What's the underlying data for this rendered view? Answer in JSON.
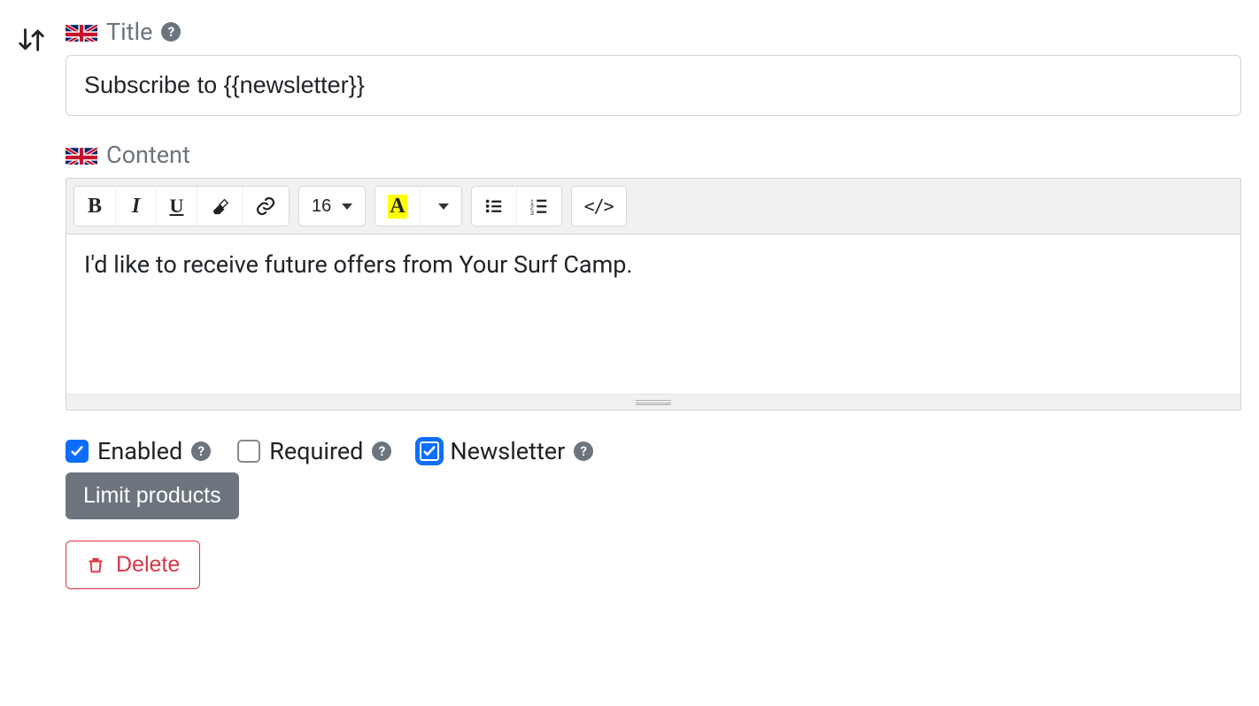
{
  "title": {
    "label": "Title",
    "value": "Subscribe to {{newsletter}}"
  },
  "content": {
    "label": "Content",
    "value": "I'd like to receive future offers from Your Surf Camp."
  },
  "toolbar": {
    "font_size": "16"
  },
  "options": {
    "enabled": {
      "label": "Enabled",
      "checked": true
    },
    "required": {
      "label": "Required",
      "checked": false
    },
    "newsletter": {
      "label": "Newsletter",
      "checked": true
    }
  },
  "buttons": {
    "limit_products": "Limit products",
    "delete": "Delete"
  }
}
